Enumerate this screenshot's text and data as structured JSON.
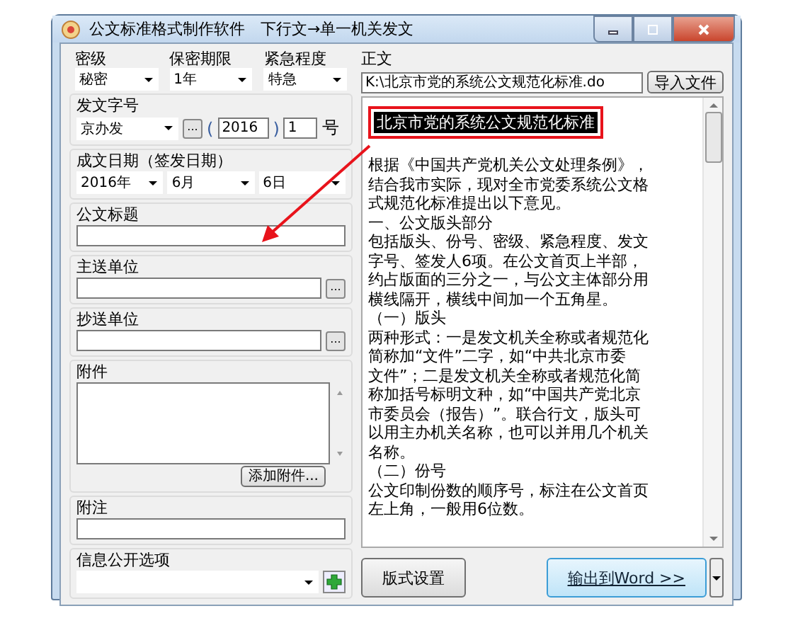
{
  "window": {
    "title": "公文标准格式制作软件　下行文→单一机关发文"
  },
  "selects": [
    {
      "label": "密级",
      "value": "秘密"
    },
    {
      "label": "保密期限",
      "value": "1年"
    },
    {
      "label": "紧急程度",
      "value": "特急"
    }
  ],
  "doc_number": {
    "label": "发文字号",
    "prefix": "京办发",
    "browse": "...",
    "open_paren": "(",
    "year": "2016",
    "close_paren": ")",
    "number": "1",
    "suffix": "号"
  },
  "date": {
    "label": "成文日期（签发日期）",
    "year": "2016年",
    "month": "6月",
    "day": "6日"
  },
  "title_field": {
    "label": "公文标题"
  },
  "main_recipient": {
    "label": "主送单位",
    "browse": "..."
  },
  "cc": {
    "label": "抄送单位",
    "browse": "..."
  },
  "attachments": {
    "label": "附件",
    "button": "添加附件..."
  },
  "note": {
    "label": "附注"
  },
  "disclosure": {
    "label": "信息公开选项"
  },
  "body": {
    "label": "正文",
    "file_path": "K:\\北京市党的系统公文规范化标准.do",
    "import_button": "导入文件",
    "heading": {
      "text": "北京市党的系统公文规范化标准",
      "selected": true,
      "annotated": true
    },
    "lines": [
      "根据《中国共产党机关公文处理条例》，",
      "结合我市实际，现对全市党委系统公文格",
      "式规范化标准提出以下意见。",
      "一、公文版头部分",
      "包括版头、份号、密级、紧急程度、发文",
      "字号、签发人6项。在公文首页上半部，",
      "约占版面的三分之一，与公文主体部分用",
      "横线隔开，横线中间加一个五角星。",
      "（一）版头",
      "两种形式：一是发文机关全称或者规范化",
      "简称加“文件”二字，如“中共北京市委",
      "文件”；二是发文机关全称或者规范化简",
      "称加括号标明文种，如“中国共产党北京",
      "市委员会（报告）”。联合行文，版头可",
      "以用主办机关名称，也可以并用几个机关",
      "名称。",
      "（二）份号",
      "公文印制份数的顺序号，标注在公文首页",
      "左上角，一般用6位数。"
    ]
  },
  "buttons": [
    {
      "label": "版式设置",
      "kind": "plain"
    },
    {
      "label": "输出到Word >>",
      "kind": "primary"
    }
  ]
}
